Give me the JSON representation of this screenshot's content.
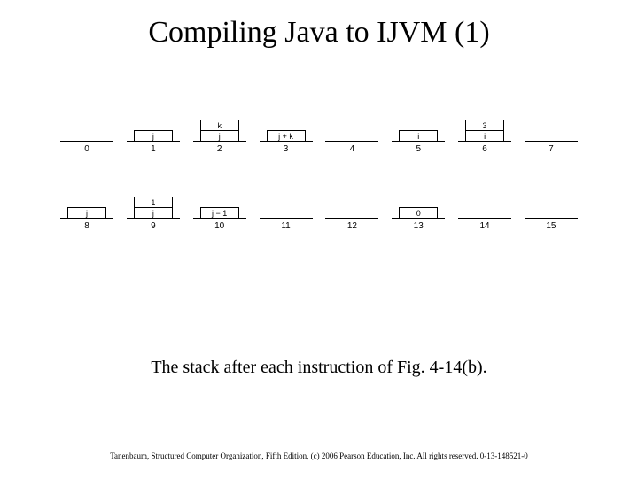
{
  "title": "Compiling Java to IJVM (1)",
  "caption": "The stack after each instruction of Fig. 4-14(b).",
  "footer": "Tanenbaum, Structured Computer Organization, Fifth Edition, (c) 2006 Pearson Education, Inc. All rights reserved. 0-13-148521-0",
  "stacks": [
    {
      "id": "0",
      "cells": []
    },
    {
      "id": "1",
      "cells": [
        "j"
      ]
    },
    {
      "id": "2",
      "cells": [
        "k",
        "j"
      ]
    },
    {
      "id": "3",
      "cells": [
        "j + k"
      ]
    },
    {
      "id": "4",
      "cells": []
    },
    {
      "id": "5",
      "cells": [
        "i"
      ]
    },
    {
      "id": "6",
      "cells": [
        "3",
        "i"
      ]
    },
    {
      "id": "7",
      "cells": []
    },
    {
      "id": "8",
      "cells": [
        "j"
      ]
    },
    {
      "id": "9",
      "cells": [
        "1",
        "j"
      ]
    },
    {
      "id": "10",
      "cells": [
        "j − 1"
      ]
    },
    {
      "id": "11",
      "cells": []
    },
    {
      "id": "12",
      "cells": []
    },
    {
      "id": "13",
      "cells": [
        "0"
      ]
    },
    {
      "id": "14",
      "cells": []
    },
    {
      "id": "15",
      "cells": []
    }
  ],
  "chart_data": {
    "type": "table",
    "description": "Operand stack contents after each IJVM instruction index (top of stack first).",
    "instructions": [
      {
        "index": 0,
        "stack_top_to_bottom": []
      },
      {
        "index": 1,
        "stack_top_to_bottom": [
          "j"
        ]
      },
      {
        "index": 2,
        "stack_top_to_bottom": [
          "k",
          "j"
        ]
      },
      {
        "index": 3,
        "stack_top_to_bottom": [
          "j + k"
        ]
      },
      {
        "index": 4,
        "stack_top_to_bottom": []
      },
      {
        "index": 5,
        "stack_top_to_bottom": [
          "i"
        ]
      },
      {
        "index": 6,
        "stack_top_to_bottom": [
          "3",
          "i"
        ]
      },
      {
        "index": 7,
        "stack_top_to_bottom": []
      },
      {
        "index": 8,
        "stack_top_to_bottom": [
          "j"
        ]
      },
      {
        "index": 9,
        "stack_top_to_bottom": [
          "1",
          "j"
        ]
      },
      {
        "index": 10,
        "stack_top_to_bottom": [
          "j − 1"
        ]
      },
      {
        "index": 11,
        "stack_top_to_bottom": []
      },
      {
        "index": 12,
        "stack_top_to_bottom": []
      },
      {
        "index": 13,
        "stack_top_to_bottom": [
          "0"
        ]
      },
      {
        "index": 14,
        "stack_top_to_bottom": []
      },
      {
        "index": 15,
        "stack_top_to_bottom": []
      }
    ]
  }
}
